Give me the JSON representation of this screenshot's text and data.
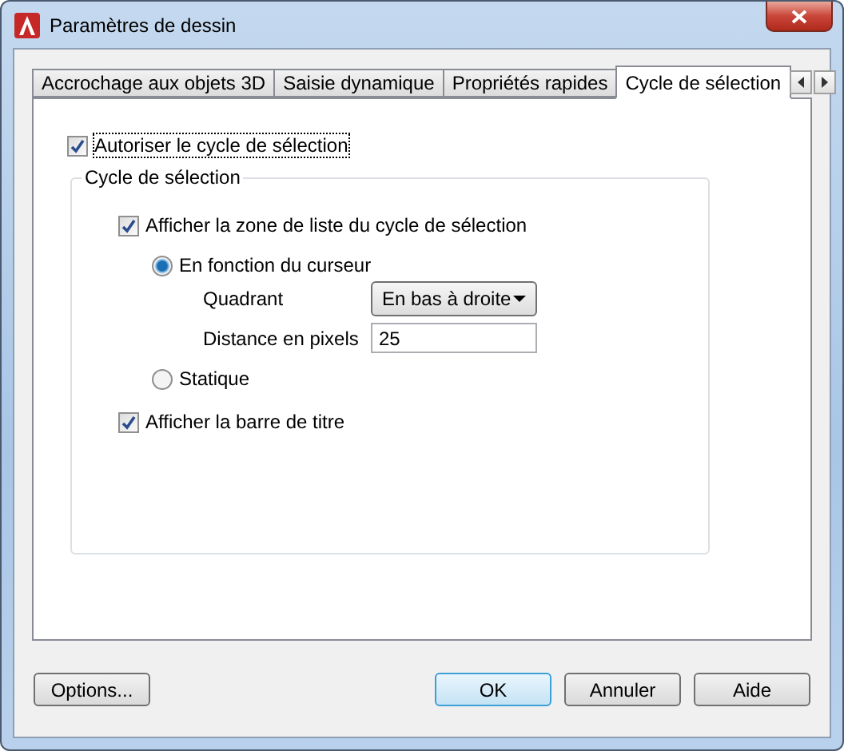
{
  "window": {
    "title": "Paramètres de dessin"
  },
  "tabs": [
    {
      "label": "Accrochage aux objets 3D",
      "selected": false
    },
    {
      "label": "Saisie dynamique",
      "selected": false
    },
    {
      "label": "Propriétés rapides",
      "selected": false
    },
    {
      "label": "Cycle de sélection",
      "selected": true
    }
  ],
  "allow_cycling": {
    "label": "Autoriser le cycle de sélection",
    "checked": true
  },
  "group": {
    "title": "Cycle de sélection",
    "show_list": {
      "label": "Afficher la zone de liste du cycle de sélection",
      "checked": true
    },
    "modes": [
      {
        "label": "En fonction du curseur",
        "selected": true
      },
      {
        "label": "Statique",
        "selected": false
      }
    ],
    "quadrant": {
      "label": "Quadrant",
      "value": "En bas à droite"
    },
    "distance": {
      "label": "Distance en pixels",
      "value": "25"
    },
    "show_title_bar": {
      "label": "Afficher la barre de titre",
      "checked": true
    }
  },
  "buttons": [
    {
      "label": "Options...",
      "default": false
    },
    {
      "label": "OK",
      "default": true
    },
    {
      "label": "Annuler",
      "default": false
    },
    {
      "label": "Aide",
      "default": false
    }
  ]
}
